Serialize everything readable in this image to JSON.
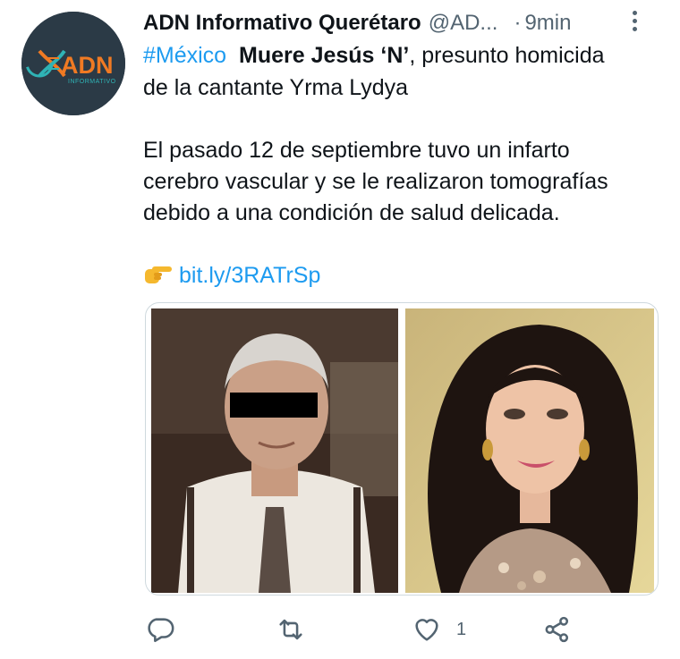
{
  "tweet": {
    "author": {
      "name": "ADN Informativo Querétaro",
      "handle": "@AD...",
      "avatar_text": "ADN",
      "avatar_subtext": "INFORMATIVO"
    },
    "separator": "·",
    "time": "9min",
    "hashtag": "#México",
    "headline_bold": "Muere Jesús ‘N’",
    "headline_rest": ", presunto homicida",
    "headline_line2": "de la cantante Yrma Lydya",
    "body_lines": [
      "El pasado 12 de septiembre tuvo un infarto",
      "cerebro vascular y se le realizaron tomografías",
      "debido a una condición de salud delicada."
    ],
    "link": "bit.ly/3RATrSp",
    "link_icon": "backhand-index-pointing-right-emoji"
  },
  "actions": {
    "reply": {
      "icon": "reply-icon"
    },
    "retweet": {
      "icon": "retweet-icon"
    },
    "like": {
      "icon": "heart-icon",
      "count": "1"
    },
    "share": {
      "icon": "share-icon"
    }
  },
  "colors": {
    "accent": "#1d9bf0",
    "text": "#0f1419",
    "secondary": "#536471",
    "border": "#cfd9de",
    "avatar_bg": "#2b3a46",
    "avatar_orange": "#f07a23",
    "avatar_teal": "#2fb3b5"
  }
}
